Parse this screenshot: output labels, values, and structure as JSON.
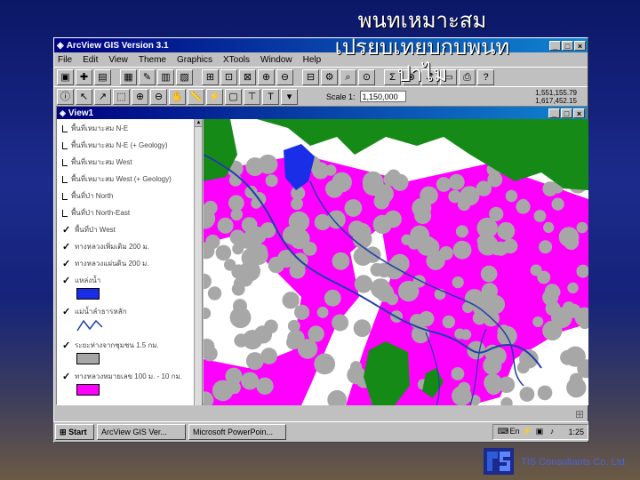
{
  "slide": {
    "title": "พนทเหมาะสม\nเปรยบเทยบกบพนท\nปาไม",
    "footer": "TIS Consultants Co. Ltd."
  },
  "app": {
    "title": "ArcView GIS Version 3.1",
    "menu": [
      "File",
      "Edit",
      "View",
      "Theme",
      "Graphics",
      "XTools",
      "Window",
      "Help"
    ],
    "scale_label": "Scale 1:",
    "scale_value": "1,150,000",
    "coords": [
      "1,551,155.79",
      "1,617,452.15"
    ]
  },
  "view": {
    "title": "View1",
    "layers": [
      {
        "label": "พื้นที่เหมาะสม N-E",
        "checked": false
      },
      {
        "label": "พื้นที่เหมาะสม N-E (+ Geology)",
        "checked": false
      },
      {
        "label": "พื้นที่เหมาะสม West",
        "checked": false
      },
      {
        "label": "พื้นที่เหมาะสม West (+ Geology)",
        "checked": false
      },
      {
        "label": "พื้นที่ป่า North",
        "checked": false
      },
      {
        "label": "พื้นที่ป่า North-East",
        "checked": false
      },
      {
        "label": "พื้นที่ป่า West",
        "checked": true
      },
      {
        "label": "ทางหลวงเพิ่มเติม 200 ม.",
        "checked": true
      },
      {
        "label": "ทางหลวงแผ่นดิน 200 ม.",
        "checked": true
      },
      {
        "label": "แหล่งน้ำ",
        "checked": true
      },
      {
        "label": "แม่น้ำลำธารหลัก",
        "checked": true
      },
      {
        "label": "ระยะห่างจากชุมชน 1.5 กม.",
        "checked": true
      },
      {
        "label": "ทางหลวงหมายเลข 100 ม. - 10 กม.",
        "checked": true
      }
    ]
  },
  "colors": {
    "forest": "#168a16",
    "suitable": "#ff00ff",
    "buffer": "#a7a7a7",
    "water": "#1a2ee8",
    "river": "#1e3fa8"
  },
  "taskbar": {
    "start": "Start",
    "task1": "ArcView GIS Ver...",
    "task2": "Microsoft PowerPoin...",
    "clock": "1:25"
  }
}
